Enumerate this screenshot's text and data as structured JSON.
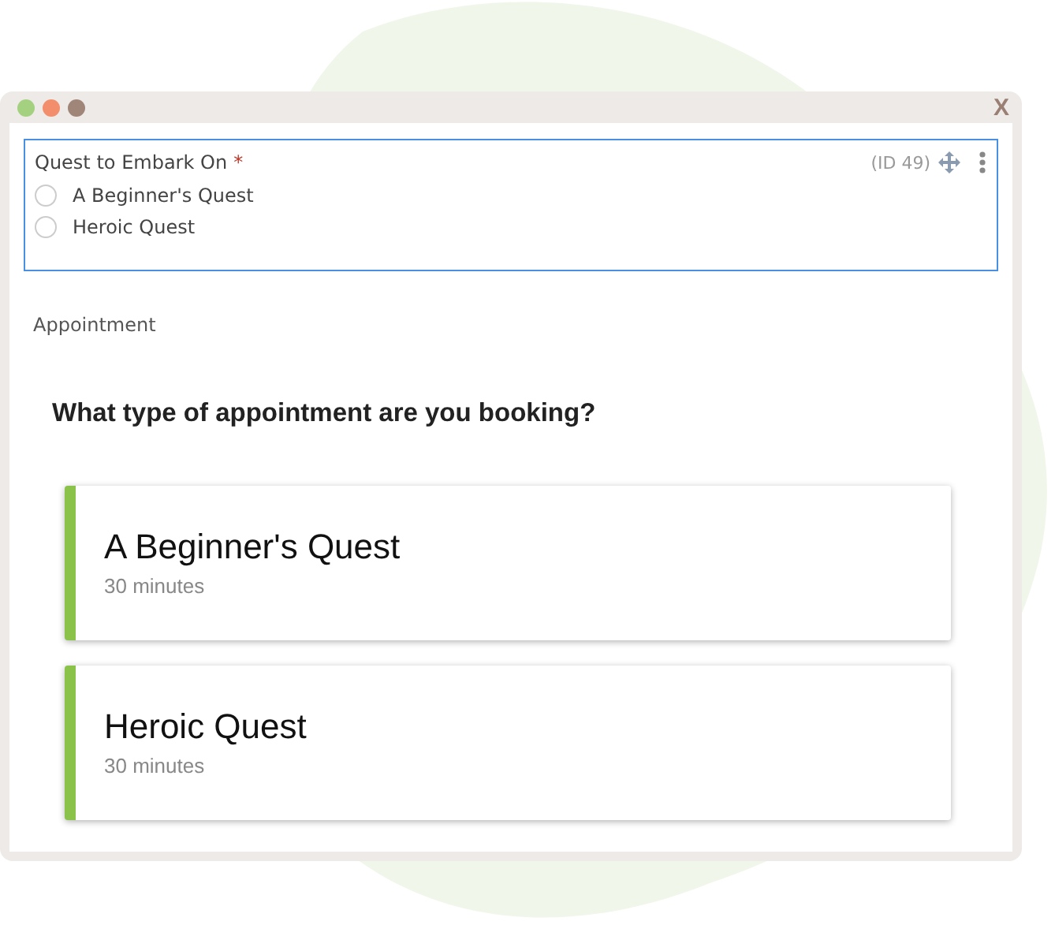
{
  "window": {
    "close_label": "X"
  },
  "question_field": {
    "label": "Quest to Embark On",
    "required_mark": "*",
    "id_label": "(ID 49)",
    "options": [
      {
        "label": "A Beginner's Quest",
        "selected": false
      },
      {
        "label": "Heroic Quest",
        "selected": false
      }
    ]
  },
  "appointment": {
    "section_label": "Appointment",
    "heading": "What type of appointment are you booking?",
    "cards": [
      {
        "title": "A Beginner's Quest",
        "duration": "30 minutes"
      },
      {
        "title": "Heroic Quest",
        "duration": "30 minutes"
      }
    ]
  }
}
